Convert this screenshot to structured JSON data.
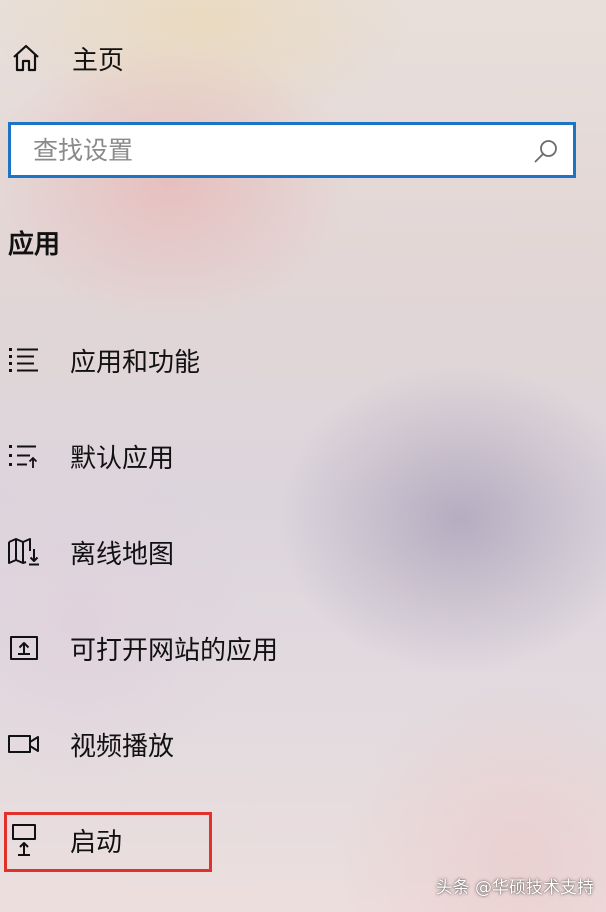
{
  "home": {
    "label": "主页",
    "icon": "home-icon"
  },
  "search": {
    "placeholder": "查找设置",
    "value": "",
    "icon": "search-icon",
    "border_color": "#1c74c4"
  },
  "section": {
    "title": "应用"
  },
  "nav": {
    "items": [
      {
        "label": "应用和功能",
        "icon": "apps-features-list-icon"
      },
      {
        "label": "默认应用",
        "icon": "default-apps-list-icon"
      },
      {
        "label": "离线地图",
        "icon": "offline-map-download-icon"
      },
      {
        "label": "可打开网站的应用",
        "icon": "apps-for-websites-icon"
      },
      {
        "label": "视频播放",
        "icon": "video-camera-icon"
      },
      {
        "label": "启动",
        "icon": "startup-monitor-icon"
      }
    ]
  },
  "annotation": {
    "highlight_color": "#e0322b",
    "highlighted_item": "启动"
  },
  "watermark": {
    "text": "头条 @华硕技术支持"
  }
}
